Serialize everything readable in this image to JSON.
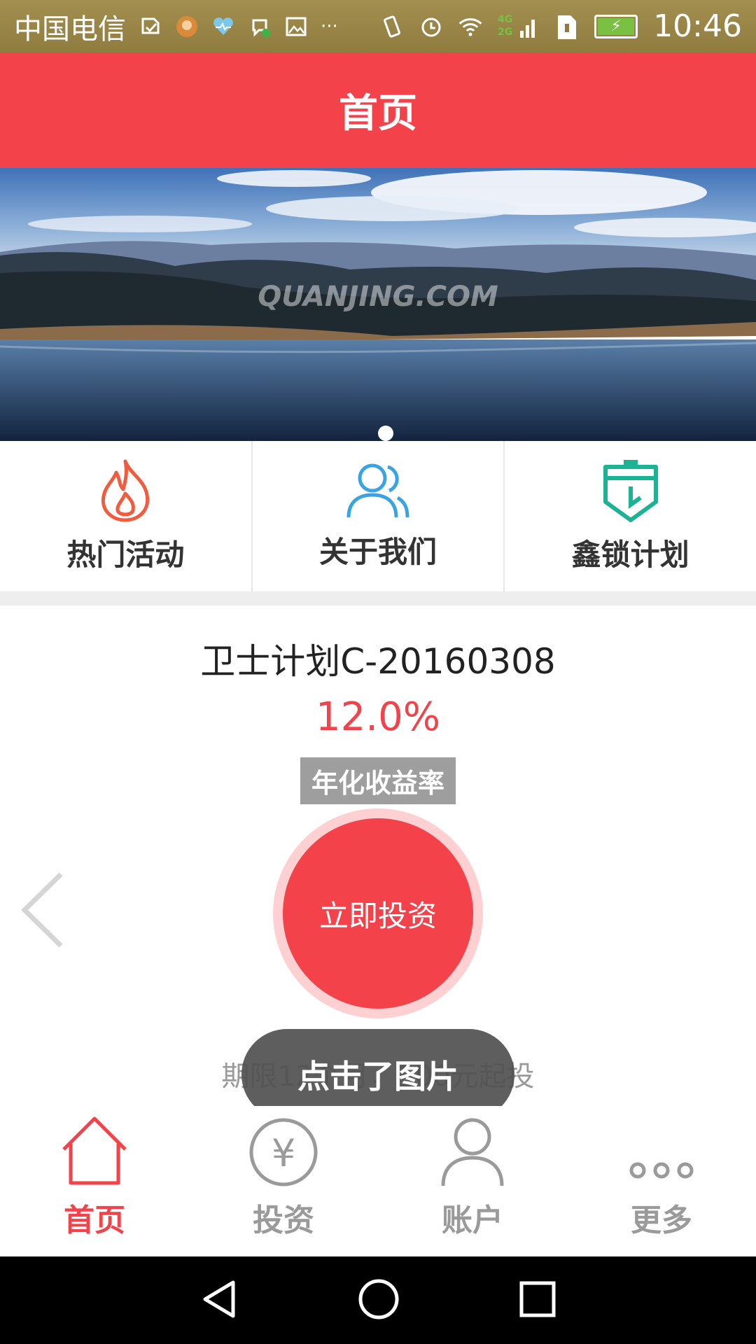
{
  "status_bar": {
    "carrier": "中国电信",
    "network_label": "4G 2G",
    "time": "10:46",
    "icons": [
      "shield-check-icon",
      "avatar-icon",
      "health-icon",
      "chat-icon",
      "image-icon",
      "more-icon",
      "vibrate-icon",
      "alarm-icon",
      "wifi-icon",
      "signal-icon",
      "sim-icon",
      "battery-icon"
    ],
    "more": "···"
  },
  "header": {
    "title": "首页"
  },
  "banner": {
    "watermark": "QUANJING.COM",
    "page_dots": 1,
    "active_dot": 0
  },
  "quick_links": [
    {
      "label": "热门活动",
      "icon": "flame-icon",
      "color": "#f25c3e"
    },
    {
      "label": "关于我们",
      "icon": "users-icon",
      "color": "#3aa3e3"
    },
    {
      "label": "鑫锁计划",
      "icon": "shield-badge-icon",
      "color": "#1ab394"
    }
  ],
  "product": {
    "title": "卫士计划C-20160308",
    "rate": "12.0%",
    "rate_label": "年化收益率",
    "invest_button": "立即投资",
    "term": "期限12个月，100元起投"
  },
  "toast": {
    "text": "点击了图片"
  },
  "bottom_nav": [
    {
      "label": "首页",
      "icon": "home-icon",
      "active": true
    },
    {
      "label": "投资",
      "icon": "yen-icon",
      "active": false
    },
    {
      "label": "账户",
      "icon": "user-icon",
      "active": false
    },
    {
      "label": "更多",
      "icon": "more-dots-icon",
      "active": false
    }
  ],
  "colors": {
    "accent": "#f4424a",
    "inactive": "#9a9a9a",
    "status_bar": "#9b884a"
  }
}
